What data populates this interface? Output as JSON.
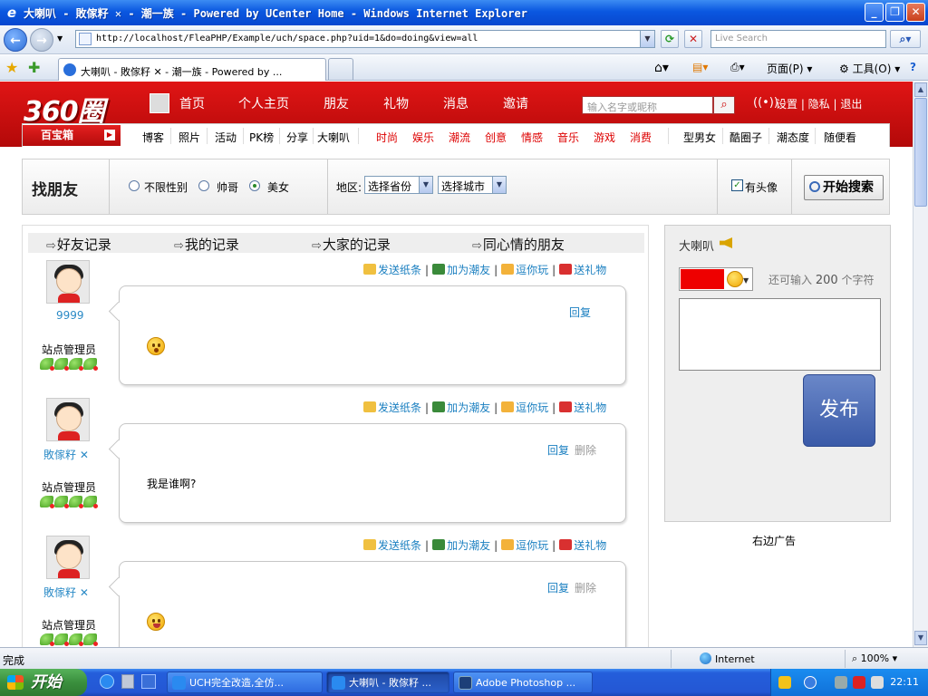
{
  "window": {
    "title": "大喇叭 - 敗傢籽 ✕ - 潮一族 - Powered by UCenter Home - Windows Internet Explorer",
    "url": "http://localhost/FleaPHP/Example/uch/space.php?uid=1&do=doing&view=all",
    "live_search_placeholder": "Live Search",
    "tab_title": "大喇叭 - 敗傢籽 ✕ - 潮一族 - Powered by ...",
    "toolbar": {
      "page": "页面(P)",
      "tools": "工具(O)"
    }
  },
  "header": {
    "logo": "360圈",
    "nav": [
      "首页",
      "个人主页",
      "朋友",
      "礼物",
      "消息",
      "邀请"
    ],
    "search_placeholder": "输入名字或昵称",
    "links": "设置 | 隐私 | 退出"
  },
  "subnav": {
    "box_label": "百宝箱",
    "group1": [
      "博客",
      "照片",
      "活动",
      "PK榜",
      "分享",
      "大喇叭"
    ],
    "group2": [
      "时尚",
      "娱乐",
      "潮流",
      "创意",
      "情感",
      "音乐",
      "游戏",
      "消费"
    ],
    "group3": [
      "型男女",
      "酷圈子",
      "潮态度",
      "随便看"
    ]
  },
  "find": {
    "title": "找朋友",
    "gender_options": [
      "不限性别",
      "帅哥",
      "美女"
    ],
    "selected_gender": "美女",
    "region_label": "地区:",
    "province": "选择省份",
    "city": "选择城市",
    "has_avatar": "有头像",
    "search_button": "开始搜索"
  },
  "feed": {
    "tabs": [
      "好友记录",
      "我的记录",
      "大家的记录",
      "同心情的朋友"
    ],
    "actions": [
      "发送纸条",
      "加为潮友",
      "逗你玩",
      "送礼物"
    ],
    "reply": "回复",
    "delete": "删除",
    "items": [
      {
        "user": "9999",
        "role": "站点管理员",
        "text": "",
        "emoji": "surprised",
        "can_delete": false
      },
      {
        "user": "敗傢籽 ✕",
        "role": "站点管理员",
        "text": "我是谁啊?",
        "emoji": "",
        "can_delete": true
      },
      {
        "user": "敗傢籽 ✕",
        "role": "站点管理员",
        "text": "",
        "emoji": "laugh",
        "can_delete": true
      }
    ]
  },
  "speaker": {
    "title": "大喇叭",
    "remain_prefix": "还可输入",
    "remain_count": "200",
    "remain_suffix": "个字符",
    "publish": "发布",
    "ad_label": "右边广告"
  },
  "status": {
    "text": "完成",
    "zone": "Internet",
    "zoom": "100%"
  },
  "taskbar": {
    "start": "开始",
    "tasks": [
      "UCH完全改造,全仿...",
      "大喇叭 - 敗傢籽 ...",
      "Adobe Photoshop ..."
    ],
    "clock": "22:11"
  }
}
